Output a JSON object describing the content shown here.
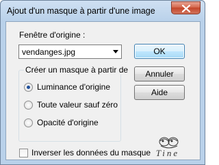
{
  "window": {
    "title": "Ajout d'un masque à partir d'une image"
  },
  "source": {
    "label": "Fenêtre d'origine :",
    "selected": "vendanges.jpg"
  },
  "buttons": {
    "ok": "OK",
    "cancel": "Annuler",
    "help": "Aide"
  },
  "group": {
    "title": "Créer un masque à partir de",
    "options": [
      {
        "label": "Luminance d'origine",
        "checked": true
      },
      {
        "label": "Toute valeur sauf zéro",
        "checked": false
      },
      {
        "label": "Opacité d'origine",
        "checked": false
      }
    ]
  },
  "invert": {
    "label": "Inverser les données du masque",
    "checked": false
  },
  "logo": {
    "text": "Tine"
  }
}
